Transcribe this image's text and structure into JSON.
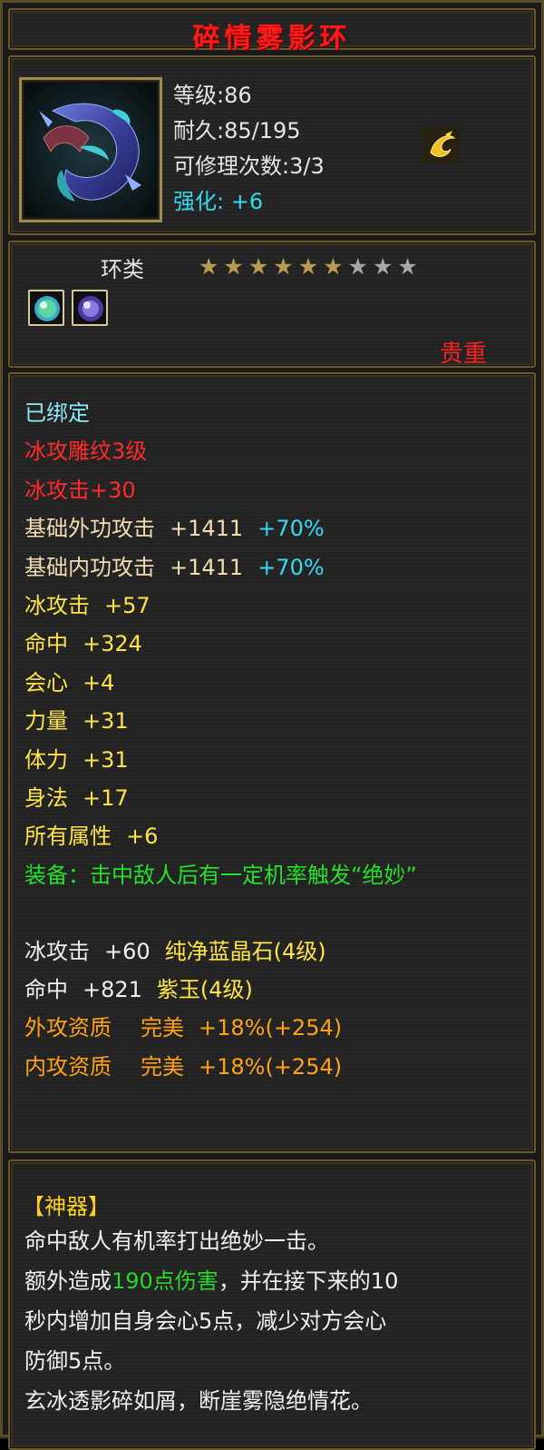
{
  "title": "碎情雾影环",
  "header": {
    "level": "等级:86",
    "durability": "耐久:85/195",
    "repair": "可修理次数:3/3",
    "enhance_label": "强化:",
    "enhance_value": "+6",
    "badge_icon": "gold-swirl-icon"
  },
  "type": {
    "label": "环类",
    "stars_total": 9,
    "stars_filled": 6,
    "gems": [
      "green-gem-icon",
      "purple-gem-icon"
    ],
    "precious": "贵重"
  },
  "stats": {
    "bound": "已绑定",
    "engrave": "冰攻雕纹3级",
    "engrave_bonus": "冰攻击+30",
    "ext_attack_label": "基础外功攻击",
    "ext_attack_value": "+1411",
    "ext_attack_pct": "+70%",
    "int_attack_label": "基础内功攻击",
    "int_attack_value": "+1411",
    "int_attack_pct": "+70%",
    "ice_attack": "冰攻击",
    "ice_attack_value": "+57",
    "hit": "命中",
    "hit_value": "+324",
    "crit": "会心",
    "crit_value": "+4",
    "strength": "力量",
    "strength_value": "+31",
    "stamina": "体力",
    "stamina_value": "+31",
    "agility": "身法",
    "agility_value": "+17",
    "all_attr": "所有属性",
    "all_attr_value": "+6",
    "equip_effect": "装备：击中敌人后有一定机率触发“绝妙”",
    "gem1_stat": "冰攻击",
    "gem1_value": "+60",
    "gem1_name": "纯净蓝晶石(4级)",
    "gem2_stat": "命中",
    "gem2_value": "+821",
    "gem2_name": "紫玉(4级)",
    "ext_quality": "外攻资质",
    "ext_quality_grade": "完美",
    "ext_quality_value": "+18%(+254)",
    "int_quality": "内攻资质",
    "int_quality_grade": "完美",
    "int_quality_value": "+18%(+254)"
  },
  "artifact": {
    "title": "【神器】",
    "line1": "命中敌人有机率打出绝妙一击。",
    "line2_pre": "额外造成",
    "line2_hl": "190点伤害",
    "line2_post": "，并在接下来的10",
    "line3": "秒内增加自身会心5点，减少对方会心",
    "line4": "防御5点。",
    "line5": "玄冰透影碎如屑，断崖雾隐绝情花。"
  },
  "colors": {
    "title": "#ff1a1a",
    "bound": "#8ee9f5",
    "engrave": "#ff2a2a",
    "base": "#f2dcb0",
    "bonus": "#ffe34a",
    "equip": "#25e02a",
    "quality": "#ffa21a",
    "artifact_title": "#ffd21a"
  }
}
